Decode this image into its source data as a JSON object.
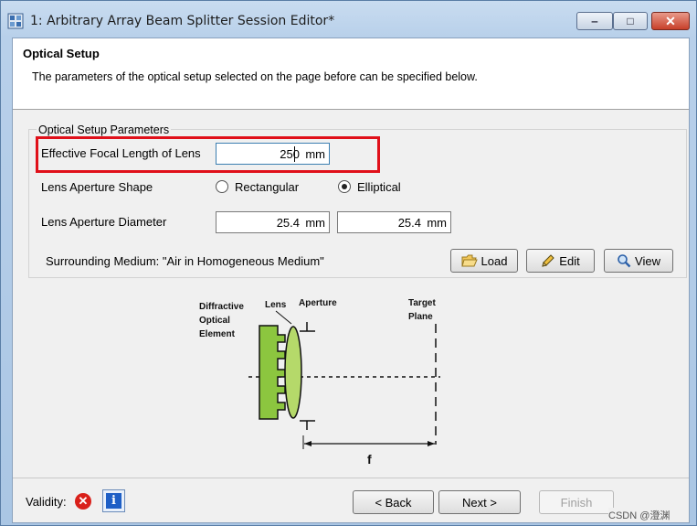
{
  "window": {
    "title": "1: Arbitrary Array Beam Splitter Session Editor*",
    "icon": "app-icon",
    "controls": {
      "minimize": "minimize-icon",
      "maximize": "maximize-icon",
      "close": "close-icon"
    }
  },
  "header": {
    "title": "Optical Setup",
    "description": "The parameters of the optical setup selected on the page before can be specified below."
  },
  "group": {
    "legend": "Optical Setup Parameters",
    "focal_length": {
      "label": "Effective Focal Length of Lens",
      "value": "250",
      "unit": "mm"
    },
    "aperture_shape": {
      "label": "Lens Aperture Shape",
      "options": [
        "Rectangular",
        "Elliptical"
      ],
      "selected": "Elliptical"
    },
    "aperture_diameter": {
      "label": "Lens Aperture Diameter",
      "x": {
        "value": "25.4",
        "unit": "mm"
      },
      "y": {
        "value": "25.4",
        "unit": "mm"
      }
    },
    "medium": {
      "text": "Surrounding Medium: \"Air in Homogeneous Medium\"",
      "buttons": {
        "load": "Load",
        "edit": "Edit",
        "view": "View"
      }
    }
  },
  "diagram": {
    "labels": {
      "doe": [
        "Diffractive",
        "Optical",
        "Element"
      ],
      "lens": "Lens",
      "aperture": "Aperture",
      "target": [
        "Target",
        "Plane"
      ],
      "focal": "f"
    },
    "colors": {
      "doe": "#8cc63f",
      "lens": "#b5d96a"
    }
  },
  "footer": {
    "validity_label": "Validity:",
    "validity_status": "error",
    "back": "< Back",
    "next": "Next >",
    "finish": "Finish",
    "watermark": "CSDN @澄渊"
  },
  "colors": {
    "highlight": "#e0101a",
    "error": "#d9201a",
    "info": "#1e5fc6"
  }
}
